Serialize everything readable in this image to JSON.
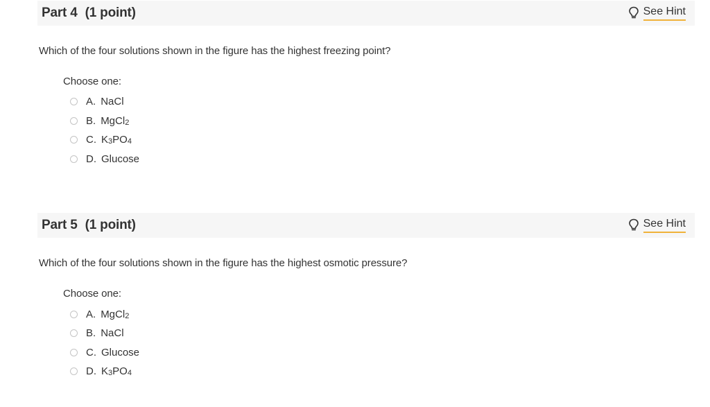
{
  "parts": [
    {
      "title": "Part 4",
      "points": "(1 point)",
      "hint_label": "See Hint",
      "hint_icon": "lightbulb-icon",
      "question": "Which of the four solutions shown in the figure has the highest freezing point?",
      "choose_label": "Choose one:",
      "options": [
        {
          "letter": "A.",
          "formula": [
            [
              "NaCl",
              ""
            ]
          ]
        },
        {
          "letter": "B.",
          "formula": [
            [
              "MgCl",
              "2"
            ]
          ]
        },
        {
          "letter": "C.",
          "formula": [
            [
              "K",
              "3"
            ],
            [
              "PO",
              "4"
            ]
          ]
        },
        {
          "letter": "D.",
          "formula": [
            [
              "Glucose",
              ""
            ]
          ]
        }
      ]
    },
    {
      "title": "Part 5",
      "points": "(1 point)",
      "hint_label": "See Hint",
      "hint_icon": "lightbulb-icon",
      "question": "Which of the four solutions shown in the figure has the highest osmotic pressure?",
      "choose_label": "Choose one:",
      "options": [
        {
          "letter": "A.",
          "formula": [
            [
              "MgCl",
              "2"
            ]
          ]
        },
        {
          "letter": "B.",
          "formula": [
            [
              "NaCl",
              ""
            ]
          ]
        },
        {
          "letter": "C.",
          "formula": [
            [
              "Glucose",
              ""
            ]
          ]
        },
        {
          "letter": "D.",
          "formula": [
            [
              "K",
              "3"
            ],
            [
              "PO",
              "4"
            ]
          ]
        }
      ]
    }
  ],
  "colors": {
    "header_bg": "#f6f6f6",
    "hint_underline": "#f0b23a",
    "text": "#333333",
    "radio_border": "#c4c4c4"
  }
}
